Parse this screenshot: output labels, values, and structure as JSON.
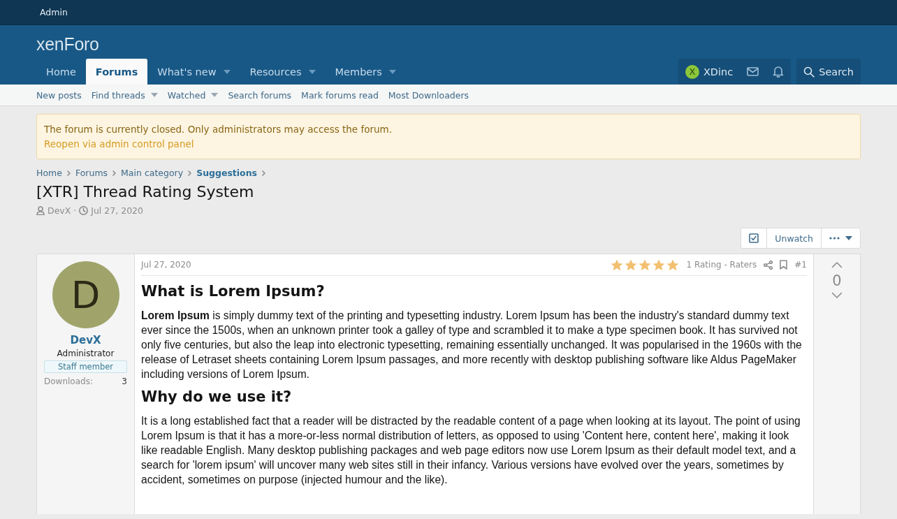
{
  "staff_bar": {
    "admin_link": "Admin"
  },
  "header": {
    "logo": "xenForo",
    "tabs": [
      {
        "label": "Home",
        "selected": false,
        "has_menu": false
      },
      {
        "label": "Forums",
        "selected": true,
        "has_menu": false
      },
      {
        "label": "What's new",
        "selected": false,
        "has_menu": true
      },
      {
        "label": "Resources",
        "selected": false,
        "has_menu": true
      },
      {
        "label": "Members",
        "selected": false,
        "has_menu": true
      }
    ],
    "user": {
      "avatar_letter": "X",
      "name": "XDinc"
    },
    "search": "Search"
  },
  "sub_nav": [
    {
      "label": "New posts",
      "has_menu": false
    },
    {
      "label": "Find threads",
      "has_menu": true
    },
    {
      "label": "Watched",
      "has_menu": true
    },
    {
      "label": "Search forums",
      "has_menu": false
    },
    {
      "label": "Mark forums read",
      "has_menu": false
    },
    {
      "label": "Most Downloaders",
      "has_menu": false
    }
  ],
  "notice": {
    "text": "The forum is currently closed. Only administrators may access the forum.",
    "link": "Reopen via admin control panel"
  },
  "breadcrumbs": [
    {
      "label": "Home",
      "current": false
    },
    {
      "label": "Forums",
      "current": false
    },
    {
      "label": "Main category",
      "current": false
    },
    {
      "label": "Suggestions",
      "current": true
    }
  ],
  "thread": {
    "title": "[XTR] Thread Rating System",
    "author": "DevX",
    "separator": "·",
    "date": "Jul 27, 2020"
  },
  "thread_actions": {
    "unwatch": "Unwatch"
  },
  "post": {
    "user": {
      "avatar_letter": "D",
      "name": "DevX",
      "title": "Administrator",
      "banner": "Staff member",
      "stats": [
        {
          "label": "Downloads:",
          "value": "3"
        }
      ]
    },
    "date": "Jul 27, 2020",
    "rating": {
      "stars": 5,
      "label": "1 Rating - Raters"
    },
    "number": "#1",
    "body": [
      {
        "kind": "heading",
        "text": "What is Lorem Ipsum?"
      },
      {
        "kind": "paragraph",
        "text": "**Lorem Ipsum** is simply dummy text of the printing and typesetting industry. Lorem Ipsum has been the industry's standard dummy text ever since the 1500s, when an unknown printer took a galley of type and scrambled it to make a type specimen book. It has survived not only five centuries, but also the leap into electronic typesetting, remaining essentially unchanged. It was popularised in the 1960s with the release of Letraset sheets containing Lorem Ipsum passages, and more recently with desktop publishing software like Aldus PageMaker including versions of Lorem Ipsum."
      },
      {
        "kind": "heading",
        "text": "Why do we use it?"
      },
      {
        "kind": "paragraph",
        "text": "It is a long established fact that a reader will be distracted by the readable content of a page when looking at its layout. The point of using Lorem Ipsum is that it has a more-or-less normal distribution of letters, as opposed to using 'Content here, content here', making it look like readable English. Many desktop publishing packages and web page editors now use Lorem Ipsum as their default model text, and a search for 'lorem ipsum' will uncover many web sites still in their infancy. Various versions have evolved over the years, sometimes by accident, sometimes on purpose (injected humour and the like)."
      }
    ],
    "votes": {
      "score": "0"
    }
  }
}
